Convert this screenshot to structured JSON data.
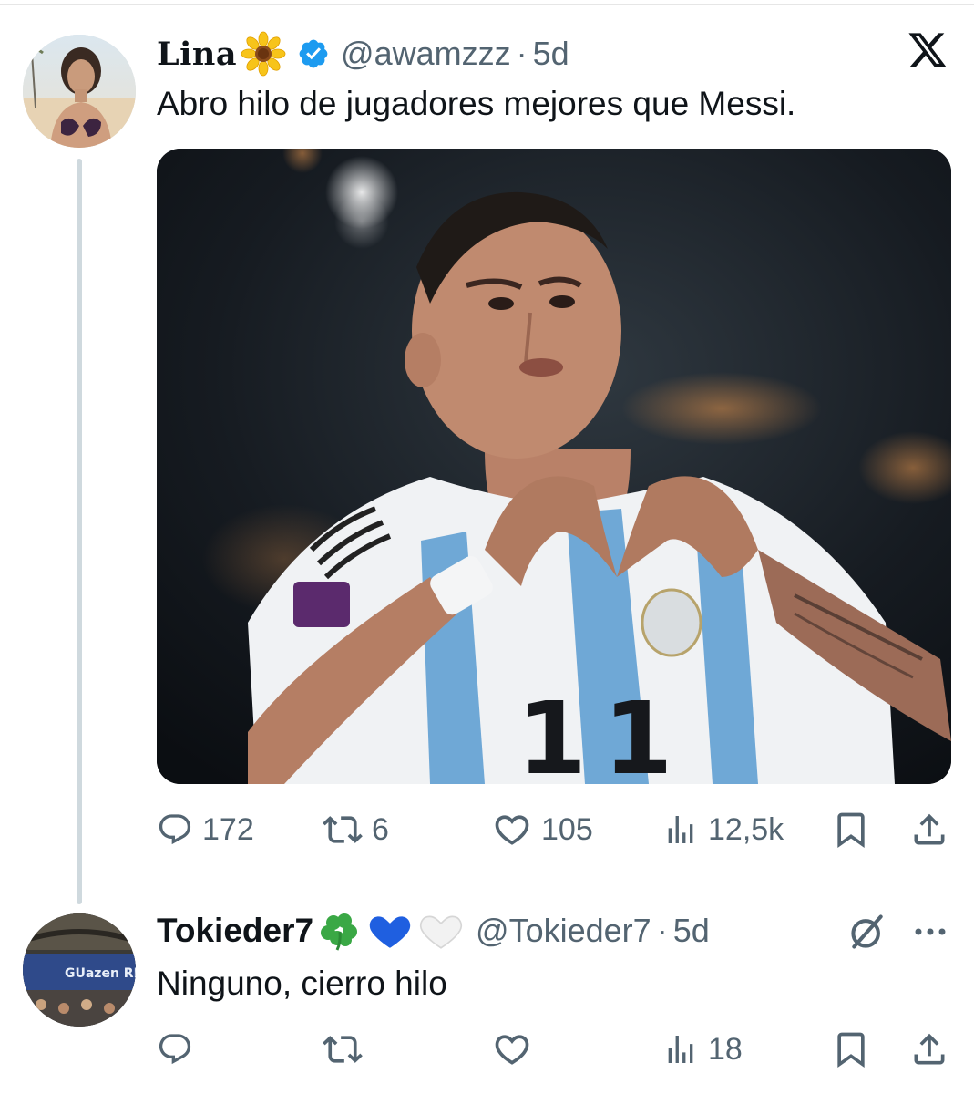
{
  "tweet_main": {
    "display_name": "Lina",
    "handle": "@awamzzz",
    "separator": "·",
    "time": "5d",
    "text": "Abro hilo de jugadores mejores que Messi.",
    "stats": {
      "replies": "172",
      "retweets": "6",
      "likes": "105",
      "views": "12,5k"
    }
  },
  "tweet_reply": {
    "display_name": "Tokieder7",
    "handle": "@Tokieder7",
    "separator": "·",
    "time": "5d",
    "text": "Ninguno, cierro hilo",
    "stats": {
      "views": "18"
    },
    "avatar_text": "GUazen REAL"
  },
  "jersey_number": "11",
  "icons": {
    "verified": "verified-badge-icon",
    "x_logo": "x-logo-icon",
    "reply": "reply-icon",
    "retweet": "retweet-icon",
    "like": "heart-icon",
    "views": "views-icon",
    "bookmark": "bookmark-icon",
    "share": "share-icon",
    "grok": "grok-icon",
    "more": "more-icon"
  },
  "colors": {
    "text": "#0f1419",
    "secondary": "#536471",
    "verified": "#1d9bf0",
    "thread_line": "#cfd9de"
  }
}
